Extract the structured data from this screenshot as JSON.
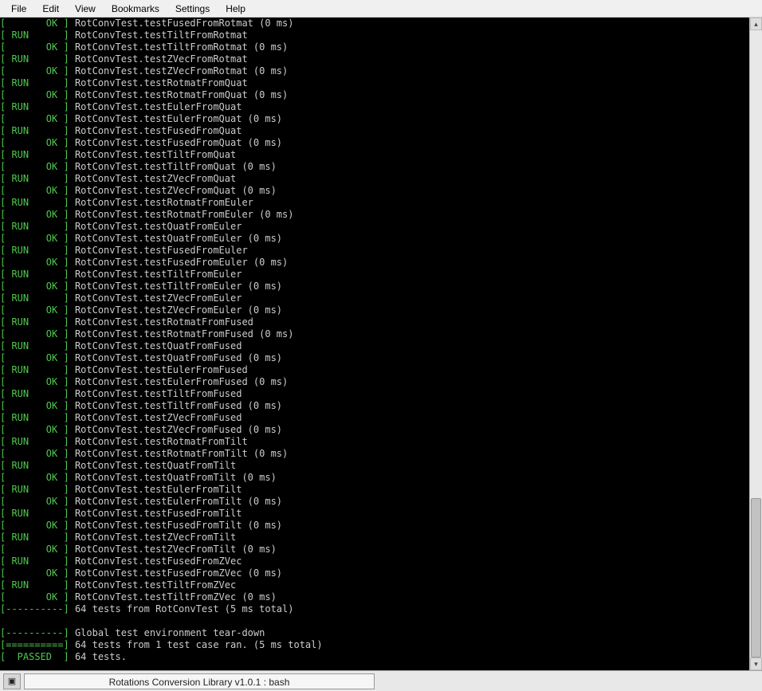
{
  "menubar": {
    "items": [
      "File",
      "Edit",
      "View",
      "Bookmarks",
      "Settings",
      "Help"
    ]
  },
  "taskbar": {
    "title": "Rotations Conversion Library v1.0.1 : bash"
  },
  "terminal": {
    "lines": [
      {
        "status": "OK",
        "text": "RotConvTest.testFusedFromRotmat (0 ms)"
      },
      {
        "status": "RUN",
        "text": "RotConvTest.testTiltFromRotmat"
      },
      {
        "status": "OK",
        "text": "RotConvTest.testTiltFromRotmat (0 ms)"
      },
      {
        "status": "RUN",
        "text": "RotConvTest.testZVecFromRotmat"
      },
      {
        "status": "OK",
        "text": "RotConvTest.testZVecFromRotmat (0 ms)"
      },
      {
        "status": "RUN",
        "text": "RotConvTest.testRotmatFromQuat"
      },
      {
        "status": "OK",
        "text": "RotConvTest.testRotmatFromQuat (0 ms)"
      },
      {
        "status": "RUN",
        "text": "RotConvTest.testEulerFromQuat"
      },
      {
        "status": "OK",
        "text": "RotConvTest.testEulerFromQuat (0 ms)"
      },
      {
        "status": "RUN",
        "text": "RotConvTest.testFusedFromQuat"
      },
      {
        "status": "OK",
        "text": "RotConvTest.testFusedFromQuat (0 ms)"
      },
      {
        "status": "RUN",
        "text": "RotConvTest.testTiltFromQuat"
      },
      {
        "status": "OK",
        "text": "RotConvTest.testTiltFromQuat (0 ms)"
      },
      {
        "status": "RUN",
        "text": "RotConvTest.testZVecFromQuat"
      },
      {
        "status": "OK",
        "text": "RotConvTest.testZVecFromQuat (0 ms)"
      },
      {
        "status": "RUN",
        "text": "RotConvTest.testRotmatFromEuler"
      },
      {
        "status": "OK",
        "text": "RotConvTest.testRotmatFromEuler (0 ms)"
      },
      {
        "status": "RUN",
        "text": "RotConvTest.testQuatFromEuler"
      },
      {
        "status": "OK",
        "text": "RotConvTest.testQuatFromEuler (0 ms)"
      },
      {
        "status": "RUN",
        "text": "RotConvTest.testFusedFromEuler"
      },
      {
        "status": "OK",
        "text": "RotConvTest.testFusedFromEuler (0 ms)"
      },
      {
        "status": "RUN",
        "text": "RotConvTest.testTiltFromEuler"
      },
      {
        "status": "OK",
        "text": "RotConvTest.testTiltFromEuler (0 ms)"
      },
      {
        "status": "RUN",
        "text": "RotConvTest.testZVecFromEuler"
      },
      {
        "status": "OK",
        "text": "RotConvTest.testZVecFromEuler (0 ms)"
      },
      {
        "status": "RUN",
        "text": "RotConvTest.testRotmatFromFused"
      },
      {
        "status": "OK",
        "text": "RotConvTest.testRotmatFromFused (0 ms)"
      },
      {
        "status": "RUN",
        "text": "RotConvTest.testQuatFromFused"
      },
      {
        "status": "OK",
        "text": "RotConvTest.testQuatFromFused (0 ms)"
      },
      {
        "status": "RUN",
        "text": "RotConvTest.testEulerFromFused"
      },
      {
        "status": "OK",
        "text": "RotConvTest.testEulerFromFused (0 ms)"
      },
      {
        "status": "RUN",
        "text": "RotConvTest.testTiltFromFused"
      },
      {
        "status": "OK",
        "text": "RotConvTest.testTiltFromFused (0 ms)"
      },
      {
        "status": "RUN",
        "text": "RotConvTest.testZVecFromFused"
      },
      {
        "status": "OK",
        "text": "RotConvTest.testZVecFromFused (0 ms)"
      },
      {
        "status": "RUN",
        "text": "RotConvTest.testRotmatFromTilt"
      },
      {
        "status": "OK",
        "text": "RotConvTest.testRotmatFromTilt (0 ms)"
      },
      {
        "status": "RUN",
        "text": "RotConvTest.testQuatFromTilt"
      },
      {
        "status": "OK",
        "text": "RotConvTest.testQuatFromTilt (0 ms)"
      },
      {
        "status": "RUN",
        "text": "RotConvTest.testEulerFromTilt"
      },
      {
        "status": "OK",
        "text": "RotConvTest.testEulerFromTilt (0 ms)"
      },
      {
        "status": "RUN",
        "text": "RotConvTest.testFusedFromTilt"
      },
      {
        "status": "OK",
        "text": "RotConvTest.testFusedFromTilt (0 ms)"
      },
      {
        "status": "RUN",
        "text": "RotConvTest.testZVecFromTilt"
      },
      {
        "status": "OK",
        "text": "RotConvTest.testZVecFromTilt (0 ms)"
      },
      {
        "status": "RUN",
        "text": "RotConvTest.testFusedFromZVec"
      },
      {
        "status": "OK",
        "text": "RotConvTest.testFusedFromZVec (0 ms)"
      },
      {
        "status": "RUN",
        "text": "RotConvTest.testTiltFromZVec"
      },
      {
        "status": "OK",
        "text": "RotConvTest.testTiltFromZVec (0 ms)"
      },
      {
        "status": "DASH",
        "text": "64 tests from RotConvTest (5 ms total)"
      },
      {
        "status": "BLANK",
        "text": ""
      },
      {
        "status": "DASH",
        "text": "Global test environment tear-down"
      },
      {
        "status": "EQSEP",
        "text": "64 tests from 1 test case ran. (5 ms total)"
      },
      {
        "status": "PASSED",
        "text": "64 tests."
      }
    ]
  }
}
